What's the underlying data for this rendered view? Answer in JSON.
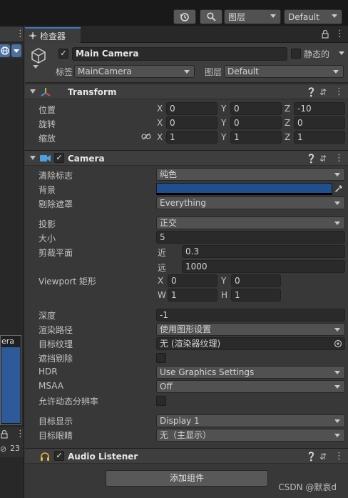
{
  "toolbar": {
    "layers_label": "图层",
    "layout_label": "Default"
  },
  "left_panel": {
    "preview_label": "era",
    "visibility_count": "23"
  },
  "inspector": {
    "tab_label": "检查器"
  },
  "gameobject": {
    "active": true,
    "name": "Main Camera",
    "static_label": "静态的",
    "tag_label": "标签",
    "tag_value": "MainCamera",
    "layer_label": "图层",
    "layer_value": "Default"
  },
  "transform": {
    "title": "Transform",
    "position_label": "位置",
    "rotation_label": "旋转",
    "scale_label": "缩放",
    "axis_x": "X",
    "axis_y": "Y",
    "axis_z": "Z",
    "position": {
      "x": "0",
      "y": "0",
      "z": "-10"
    },
    "rotation": {
      "x": "0",
      "y": "0",
      "z": "0"
    },
    "scale": {
      "x": "1",
      "y": "1",
      "z": "1"
    }
  },
  "camera": {
    "title": "Camera",
    "enabled": true,
    "clear_flags_label": "清除标志",
    "clear_flags_value": "纯色",
    "background_label": "背景",
    "background_color": "#1f4f8f",
    "culling_mask_label": "剔除遮罩",
    "culling_mask_value": "Everything",
    "projection_label": "投影",
    "projection_value": "正交",
    "size_label": "大小",
    "size_value": "5",
    "clipping_label": "剪裁平面",
    "near_label": "近",
    "near_value": "0.3",
    "far_label": "远",
    "far_value": "1000",
    "viewport_label": "Viewport 矩形",
    "viewport_x_label": "X",
    "viewport_x": "0",
    "viewport_y_label": "Y",
    "viewport_y": "0",
    "viewport_w_label": "W",
    "viewport_w": "1",
    "viewport_h_label": "H",
    "viewport_h": "1",
    "depth_label": "深度",
    "depth_value": "-1",
    "render_path_label": "渲染路径",
    "render_path_value": "使用图形设置",
    "target_texture_label": "目标纹理",
    "target_texture_value": "无 (渲染器纹理)",
    "occlusion_label": "遮挡剔除",
    "hdr_label": "HDR",
    "hdr_value": "Use Graphics Settings",
    "msaa_label": "MSAA",
    "msaa_value": "Off",
    "dynamic_res_label": "允许动态分辨率",
    "target_display_label": "目标显示",
    "target_display_value": "Display 1",
    "target_eye_label": "目标眼睛",
    "target_eye_value": "无（主显示）"
  },
  "audio_listener": {
    "title": "Audio Listener",
    "enabled": true
  },
  "add_component_label": "添加组件",
  "watermark": "CSDN @默哀d"
}
